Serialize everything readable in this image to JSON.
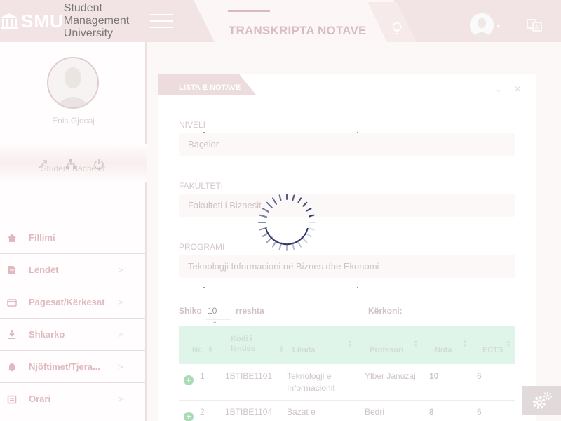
{
  "brand": {
    "name": "SMU",
    "subtitle": "Student Management University"
  },
  "header": {
    "title": "TRANSKRIPTA NOTAVE"
  },
  "user": {
    "name": "Enis Gjocaj",
    "role": "Student Bachelor"
  },
  "menu": [
    {
      "label": "Fillimi",
      "icon": "home-icon",
      "has_children": false
    },
    {
      "label": "Lëndët",
      "icon": "document-icon",
      "has_children": true
    },
    {
      "label": "Pagesat/Kërkesat",
      "icon": "card-icon",
      "has_children": true
    },
    {
      "label": "Shkarko",
      "icon": "download-icon",
      "has_children": true
    },
    {
      "label": "Njöftimet/Tjera...",
      "icon": "bell-icon",
      "has_children": true
    },
    {
      "label": "Orari",
      "icon": "calendar-icon",
      "has_children": true
    }
  ],
  "card": {
    "tab_label": "LISTA E NOTAVE",
    "fields": {
      "niveli": {
        "label": "NIVELI",
        "value": "Baçelor"
      },
      "fakulteti": {
        "label": "FAKULTETI",
        "value": "Fakulteti i Biznesit"
      },
      "programi": {
        "label": "PROGRAMI",
        "value": "Teknologji Informacioni në Biznes dhe Ekonomi"
      }
    },
    "length": {
      "before": "Shiko",
      "value": "10",
      "after": "rreshta"
    },
    "search": {
      "label": "Kërkoni:"
    }
  },
  "table": {
    "columns": [
      "Nr.",
      "Kodi i lëndës",
      "Lënda",
      "Profesori",
      "Nota",
      "ECTS"
    ],
    "rows": [
      {
        "nr": "1",
        "kodi": "1BTIBE1101",
        "lenda": "Teknologji e Informacionit",
        "profesori": "Ylber Januzaj",
        "nota": "10",
        "ects": "6"
      },
      {
        "nr": "2",
        "kodi": "1BTIBE1104",
        "lenda": "Bazat e",
        "profesori": "Bedri",
        "nota": "8",
        "ects": "6"
      }
    ]
  },
  "colors": {
    "accent": "#e0b9be",
    "header_bg": "#f2e3e4",
    "table_head": "#dff5ea",
    "spinner": "#2e3a6b"
  }
}
